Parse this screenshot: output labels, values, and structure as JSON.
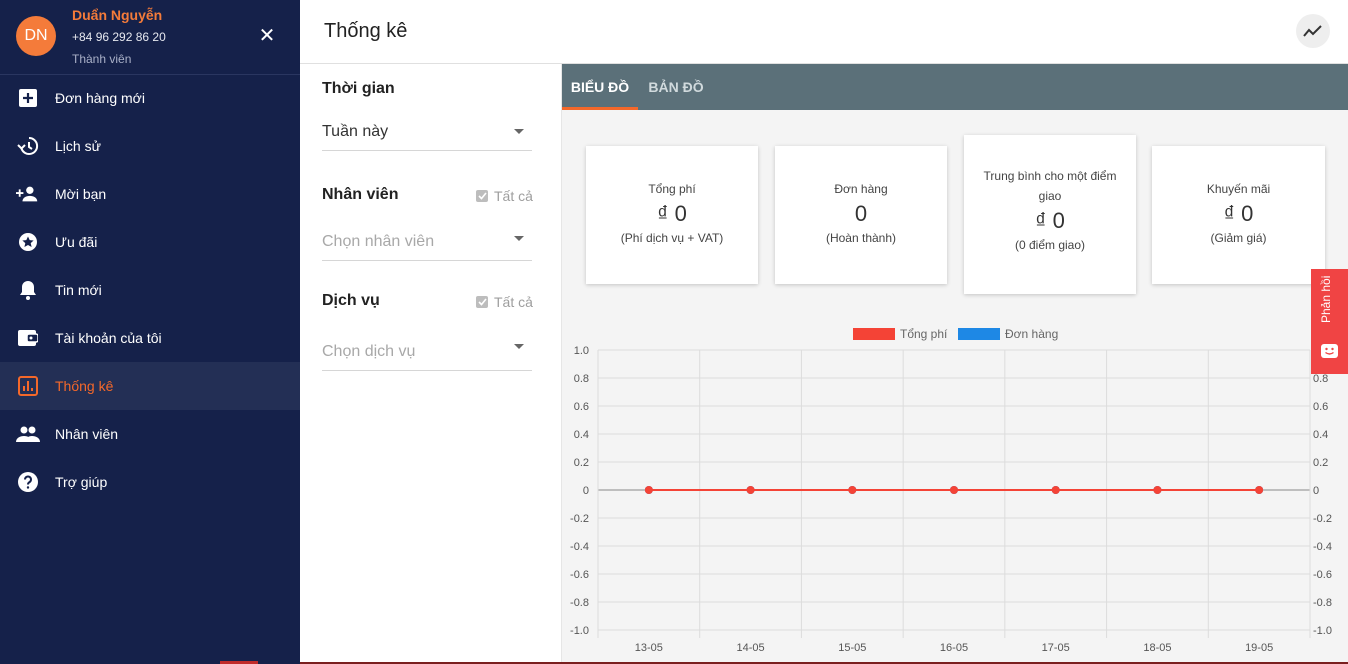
{
  "profile": {
    "initials": "DN",
    "name": "Duẩn Nguyễn",
    "phone": "+84 96 292 86 20",
    "role": "Thành viên",
    "close_icon": "close-icon"
  },
  "nav": {
    "items": [
      {
        "label": "Đơn hàng mới",
        "icon": "plus-box-icon"
      },
      {
        "label": "Lịch sử",
        "icon": "history-icon"
      },
      {
        "label": "Mời bạn",
        "icon": "person-add-icon"
      },
      {
        "label": "Ưu đãi",
        "icon": "star-circle-icon"
      },
      {
        "label": "Tin mới",
        "icon": "bell-icon"
      },
      {
        "label": "Tài khoản của tôi",
        "icon": "wallet-icon"
      },
      {
        "label": "Thống kê",
        "icon": "bar-chart-icon",
        "active": true
      },
      {
        "label": "Nhân viên",
        "icon": "people-icon"
      },
      {
        "label": "Trợ giúp",
        "icon": "help-circle-icon"
      }
    ]
  },
  "header": {
    "title": "Thống kê",
    "trend_icon": "trending-icon"
  },
  "filters": {
    "time": {
      "title": "Thời gian",
      "value": "Tuần này"
    },
    "staff": {
      "title": "Nhân viên",
      "check_label": "Tất cả",
      "placeholder": "Chọn nhân viên"
    },
    "service": {
      "title": "Dịch vụ",
      "check_label": "Tất cả",
      "placeholder": "Chọn dịch vụ"
    }
  },
  "tabs": [
    {
      "label": "BIỂU ĐỒ",
      "active": true
    },
    {
      "label": "BẢN ĐỒ",
      "active": false
    }
  ],
  "cards": [
    {
      "title": "Tổng phí",
      "value": "₫ 0",
      "sub": "(Phí dịch vụ + VAT)"
    },
    {
      "title": "Đơn hàng",
      "value": "0",
      "sub": "(Hoàn thành)"
    },
    {
      "title": "Trung bình cho một điểm giao",
      "value": "₫ 0",
      "sub": "(0 điểm giao)"
    },
    {
      "title": "Khuyến mãi",
      "value": "₫ 0",
      "sub": "(Giảm giá)"
    }
  ],
  "feedback": {
    "label": "Phản hồi"
  },
  "chart_data": {
    "type": "line",
    "categories": [
      "13-05",
      "14-05",
      "15-05",
      "16-05",
      "17-05",
      "18-05",
      "19-05"
    ],
    "series": [
      {
        "name": "Tổng phí",
        "values": [
          0,
          0,
          0,
          0,
          0,
          0,
          0
        ],
        "color": "#f44336"
      },
      {
        "name": "Đơn hàng",
        "values": [
          0,
          0,
          0,
          0,
          0,
          0,
          0
        ],
        "color": "#1e88e5"
      }
    ],
    "ylim": [
      -1.0,
      1.0
    ],
    "yticks": [
      "1.0",
      "0.8",
      "0.6",
      "0.4",
      "0.2",
      "0",
      "-0.2",
      "-0.4",
      "-0.6",
      "-0.8",
      "-1.0"
    ],
    "ytick_values": [
      1.0,
      0.8,
      0.6,
      0.4,
      0.2,
      0,
      -0.2,
      -0.4,
      -0.6,
      -0.8,
      -1.0
    ],
    "right_yticks": [
      "0.8",
      "0.6",
      "0.4",
      "0.2",
      "0",
      "-0.2",
      "-0.4",
      "-0.6",
      "-0.8",
      "-1.0"
    ],
    "right_ytick_values": [
      0.8,
      0.6,
      0.4,
      0.2,
      0,
      -0.2,
      -0.4,
      -0.6,
      -0.8,
      -1.0
    ],
    "grid": true,
    "legend": "top-center"
  },
  "colors": {
    "sidebar_bg": "#15214a",
    "accent": "#f4682a",
    "tabbar_bg": "#5b7079",
    "feedback_bg": "#f04444"
  }
}
